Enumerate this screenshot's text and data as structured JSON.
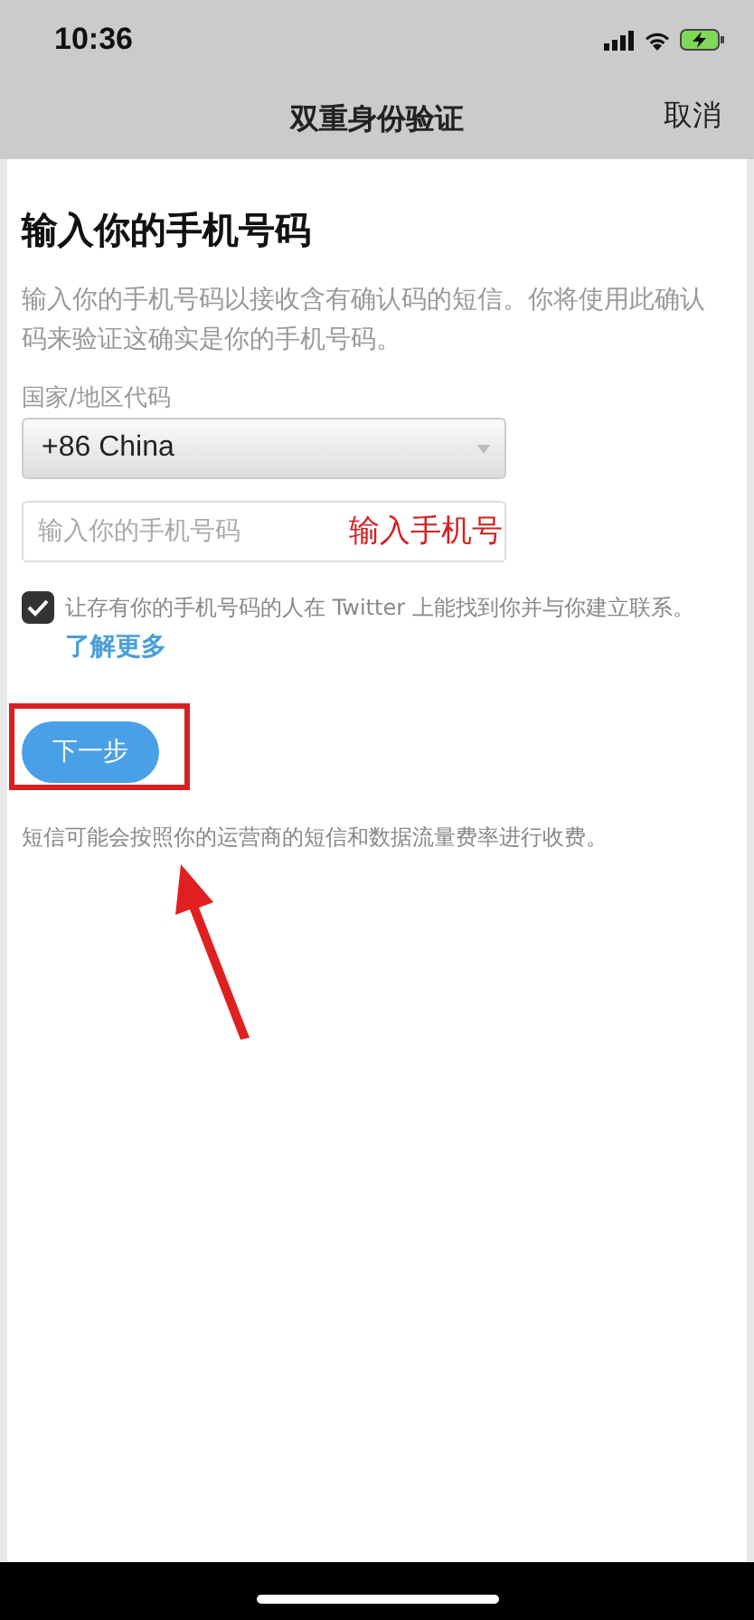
{
  "status_bar": {
    "time": "10:36"
  },
  "nav": {
    "title": "双重身份验证",
    "cancel": "取消"
  },
  "heading": "输入你的手机号码",
  "description": "输入你的手机号码以接收含有确认码的短信。你将使用此确认码来验证这确实是你的手机号码。",
  "country": {
    "label": "国家/地区代码",
    "value": "+86 China"
  },
  "phone": {
    "placeholder": "输入你的手机号码"
  },
  "discover": {
    "checked": true,
    "text": "让存有你的手机号码的人在 Twitter 上能找到你并与你建立联系。",
    "link": "了解更多"
  },
  "next_button": "下一步",
  "footnote": "短信可能会按照你的运营商的短信和数据流量费率进行收费。",
  "annotation": {
    "text": "输入手机号"
  }
}
